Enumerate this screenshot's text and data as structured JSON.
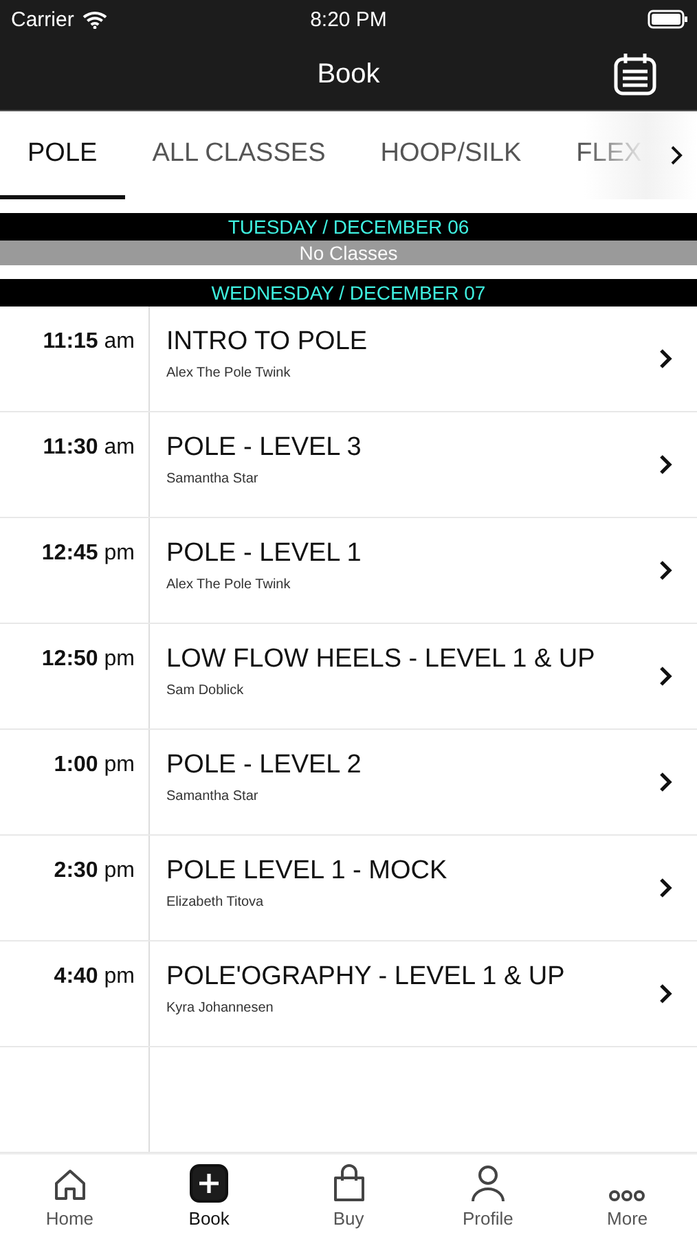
{
  "status_bar": {
    "carrier": "Carrier",
    "time": "8:20 PM"
  },
  "nav": {
    "title": "Book"
  },
  "tabs": [
    {
      "label": "POLE",
      "selected": true
    },
    {
      "label": "ALL CLASSES",
      "selected": false
    },
    {
      "label": "HOOP/SILK",
      "selected": false
    },
    {
      "label": "FLEX",
      "selected": false
    }
  ],
  "days": [
    {
      "header": "TUESDAY / DECEMBER 06",
      "empty_text": "No Classes"
    },
    {
      "header": "WEDNESDAY / DECEMBER 07",
      "classes": [
        {
          "time": "**11:15** am",
          "name": "INTRO TO POLE",
          "instructor": "Alex The Pole Twink"
        },
        {
          "time": "**11:30** am",
          "name": "POLE - LEVEL 3",
          "instructor": "Samantha Star"
        },
        {
          "time": "**12:45** pm",
          "name": "POLE - LEVEL 1",
          "instructor": "Alex The Pole Twink"
        },
        {
          "time": "**12:50** pm",
          "name": "LOW FLOW HEELS - LEVEL 1 & UP",
          "instructor": "Sam Doblick"
        },
        {
          "time": "**1:00** pm",
          "name": "POLE - LEVEL 2",
          "instructor": "Samantha Star"
        },
        {
          "time": "**2:30** pm",
          "name": "POLE LEVEL 1 - MOCK",
          "instructor": "Elizabeth Titova"
        },
        {
          "time": "**4:40** pm",
          "name": "POLE'OGRAPHY - LEVEL 1 & UP",
          "instructor": "Kyra Johannesen"
        }
      ]
    }
  ],
  "tab_bar": [
    {
      "label": "Home",
      "kind": "home",
      "selected": false
    },
    {
      "label": "Book",
      "kind": "book",
      "selected": true
    },
    {
      "label": "Buy",
      "kind": "buy",
      "selected": false
    },
    {
      "label": "Profile",
      "kind": "profile",
      "selected": false
    },
    {
      "label": "More",
      "kind": "more",
      "selected": false
    }
  ]
}
